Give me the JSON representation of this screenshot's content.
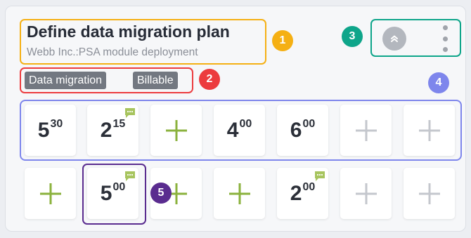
{
  "colors": {
    "annotation_1": "#f5b014",
    "annotation_2": "#ec3b3e",
    "annotation_3": "#0ea58a",
    "annotation_4": "#7e86ec",
    "annotation_5": "#5a2c8f",
    "plus_active": "#8bb23d",
    "plus_inactive": "#c4c7cd",
    "note_icon": "#a7c45e",
    "tag_bg": "#737881"
  },
  "annotations": [
    "1",
    "2",
    "3",
    "4",
    "5"
  ],
  "task": {
    "title": "Define data migration plan",
    "subtitle": "Webb Inc.:PSA module deployment"
  },
  "tags": [
    "Data migration",
    "Billable"
  ],
  "actions": {
    "collapse_icon": "chevron-double-up-icon",
    "menu_icon": "kebab-menu-icon"
  },
  "rows": [
    [
      {
        "type": "time",
        "hours": "5",
        "minutes": "30",
        "note": false
      },
      {
        "type": "time",
        "hours": "2",
        "minutes": "15",
        "note": true
      },
      {
        "type": "add",
        "active": true
      },
      {
        "type": "time",
        "hours": "4",
        "minutes": "00",
        "note": false
      },
      {
        "type": "time",
        "hours": "6",
        "minutes": "00",
        "note": false
      },
      {
        "type": "add",
        "active": false
      },
      {
        "type": "add",
        "active": false
      }
    ],
    [
      {
        "type": "add",
        "active": true
      },
      {
        "type": "time",
        "hours": "5",
        "minutes": "00",
        "note": true
      },
      {
        "type": "add",
        "active": true
      },
      {
        "type": "add",
        "active": true
      },
      {
        "type": "time",
        "hours": "2",
        "minutes": "00",
        "note": true
      },
      {
        "type": "add",
        "active": false
      },
      {
        "type": "add",
        "active": false
      }
    ]
  ]
}
